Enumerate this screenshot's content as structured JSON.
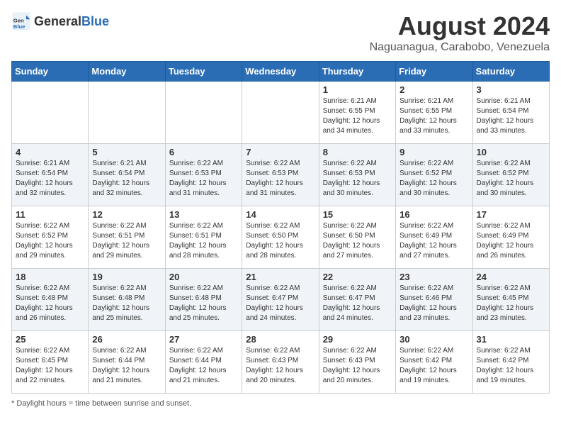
{
  "header": {
    "logo_general": "General",
    "logo_blue": "Blue",
    "month_year": "August 2024",
    "location": "Naguanagua, Carabobo, Venezuela"
  },
  "weekdays": [
    "Sunday",
    "Monday",
    "Tuesday",
    "Wednesday",
    "Thursday",
    "Friday",
    "Saturday"
  ],
  "footer": {
    "note": "Daylight hours"
  },
  "weeks": [
    {
      "days": [
        {
          "number": "",
          "info": ""
        },
        {
          "number": "",
          "info": ""
        },
        {
          "number": "",
          "info": ""
        },
        {
          "number": "",
          "info": ""
        },
        {
          "number": "1",
          "info": "Sunrise: 6:21 AM\nSunset: 6:55 PM\nDaylight: 12 hours\nand 34 minutes."
        },
        {
          "number": "2",
          "info": "Sunrise: 6:21 AM\nSunset: 6:55 PM\nDaylight: 12 hours\nand 33 minutes."
        },
        {
          "number": "3",
          "info": "Sunrise: 6:21 AM\nSunset: 6:54 PM\nDaylight: 12 hours\nand 33 minutes."
        }
      ]
    },
    {
      "days": [
        {
          "number": "4",
          "info": "Sunrise: 6:21 AM\nSunset: 6:54 PM\nDaylight: 12 hours\nand 32 minutes."
        },
        {
          "number": "5",
          "info": "Sunrise: 6:21 AM\nSunset: 6:54 PM\nDaylight: 12 hours\nand 32 minutes."
        },
        {
          "number": "6",
          "info": "Sunrise: 6:22 AM\nSunset: 6:53 PM\nDaylight: 12 hours\nand 31 minutes."
        },
        {
          "number": "7",
          "info": "Sunrise: 6:22 AM\nSunset: 6:53 PM\nDaylight: 12 hours\nand 31 minutes."
        },
        {
          "number": "8",
          "info": "Sunrise: 6:22 AM\nSunset: 6:53 PM\nDaylight: 12 hours\nand 30 minutes."
        },
        {
          "number": "9",
          "info": "Sunrise: 6:22 AM\nSunset: 6:52 PM\nDaylight: 12 hours\nand 30 minutes."
        },
        {
          "number": "10",
          "info": "Sunrise: 6:22 AM\nSunset: 6:52 PM\nDaylight: 12 hours\nand 30 minutes."
        }
      ]
    },
    {
      "days": [
        {
          "number": "11",
          "info": "Sunrise: 6:22 AM\nSunset: 6:52 PM\nDaylight: 12 hours\nand 29 minutes."
        },
        {
          "number": "12",
          "info": "Sunrise: 6:22 AM\nSunset: 6:51 PM\nDaylight: 12 hours\nand 29 minutes."
        },
        {
          "number": "13",
          "info": "Sunrise: 6:22 AM\nSunset: 6:51 PM\nDaylight: 12 hours\nand 28 minutes."
        },
        {
          "number": "14",
          "info": "Sunrise: 6:22 AM\nSunset: 6:50 PM\nDaylight: 12 hours\nand 28 minutes."
        },
        {
          "number": "15",
          "info": "Sunrise: 6:22 AM\nSunset: 6:50 PM\nDaylight: 12 hours\nand 27 minutes."
        },
        {
          "number": "16",
          "info": "Sunrise: 6:22 AM\nSunset: 6:49 PM\nDaylight: 12 hours\nand 27 minutes."
        },
        {
          "number": "17",
          "info": "Sunrise: 6:22 AM\nSunset: 6:49 PM\nDaylight: 12 hours\nand 26 minutes."
        }
      ]
    },
    {
      "days": [
        {
          "number": "18",
          "info": "Sunrise: 6:22 AM\nSunset: 6:48 PM\nDaylight: 12 hours\nand 26 minutes."
        },
        {
          "number": "19",
          "info": "Sunrise: 6:22 AM\nSunset: 6:48 PM\nDaylight: 12 hours\nand 25 minutes."
        },
        {
          "number": "20",
          "info": "Sunrise: 6:22 AM\nSunset: 6:48 PM\nDaylight: 12 hours\nand 25 minutes."
        },
        {
          "number": "21",
          "info": "Sunrise: 6:22 AM\nSunset: 6:47 PM\nDaylight: 12 hours\nand 24 minutes."
        },
        {
          "number": "22",
          "info": "Sunrise: 6:22 AM\nSunset: 6:47 PM\nDaylight: 12 hours\nand 24 minutes."
        },
        {
          "number": "23",
          "info": "Sunrise: 6:22 AM\nSunset: 6:46 PM\nDaylight: 12 hours\nand 23 minutes."
        },
        {
          "number": "24",
          "info": "Sunrise: 6:22 AM\nSunset: 6:45 PM\nDaylight: 12 hours\nand 23 minutes."
        }
      ]
    },
    {
      "days": [
        {
          "number": "25",
          "info": "Sunrise: 6:22 AM\nSunset: 6:45 PM\nDaylight: 12 hours\nand 22 minutes."
        },
        {
          "number": "26",
          "info": "Sunrise: 6:22 AM\nSunset: 6:44 PM\nDaylight: 12 hours\nand 21 minutes."
        },
        {
          "number": "27",
          "info": "Sunrise: 6:22 AM\nSunset: 6:44 PM\nDaylight: 12 hours\nand 21 minutes."
        },
        {
          "number": "28",
          "info": "Sunrise: 6:22 AM\nSunset: 6:43 PM\nDaylight: 12 hours\nand 20 minutes."
        },
        {
          "number": "29",
          "info": "Sunrise: 6:22 AM\nSunset: 6:43 PM\nDaylight: 12 hours\nand 20 minutes."
        },
        {
          "number": "30",
          "info": "Sunrise: 6:22 AM\nSunset: 6:42 PM\nDaylight: 12 hours\nand 19 minutes."
        },
        {
          "number": "31",
          "info": "Sunrise: 6:22 AM\nSunset: 6:42 PM\nDaylight: 12 hours\nand 19 minutes."
        }
      ]
    }
  ]
}
